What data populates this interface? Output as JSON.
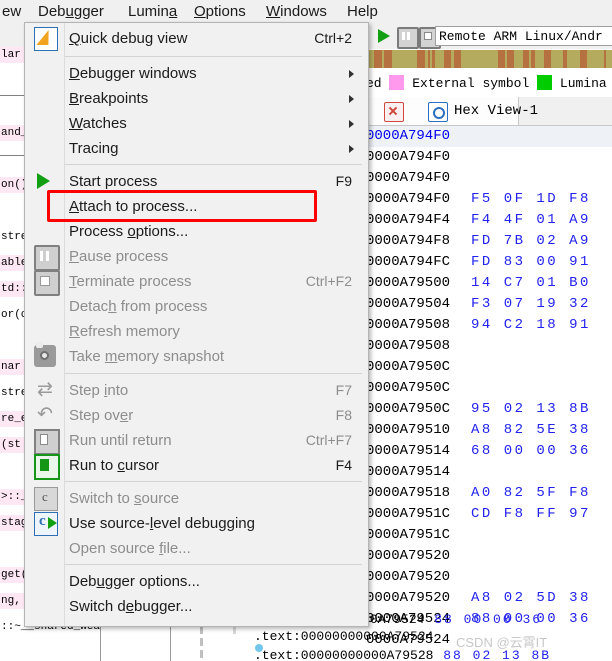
{
  "menubar": {
    "items": [
      {
        "label": "ew",
        "accel_index": -1
      },
      {
        "label": "Debugger",
        "accel_index": 3
      },
      {
        "label": "Lumina",
        "accel_index": 4
      },
      {
        "label": "Options",
        "accel_index": 0
      },
      {
        "label": "Windows",
        "accel_index": 0
      },
      {
        "label": "Help",
        "accel_index": -1
      }
    ]
  },
  "debugger_menu": {
    "items": [
      {
        "label": "Quick debug view",
        "accel": "Ctrl+2",
        "icon": "quick-debug-view-icon",
        "disabled": false,
        "submenu": false,
        "underline": 0
      },
      {
        "label": "Debugger windows",
        "accel": "",
        "icon": "",
        "disabled": false,
        "submenu": true,
        "underline": 0
      },
      {
        "label": "Breakpoints",
        "accel": "",
        "icon": "",
        "disabled": false,
        "submenu": true,
        "underline": 0
      },
      {
        "label": "Watches",
        "accel": "",
        "icon": "",
        "disabled": false,
        "submenu": true,
        "underline": 0
      },
      {
        "label": "Tracing",
        "accel": "",
        "icon": "",
        "disabled": false,
        "submenu": true,
        "underline": 6
      },
      {
        "label": "Start process",
        "accel": "F9",
        "icon": "play-icon",
        "disabled": false,
        "submenu": false,
        "underline": -1
      },
      {
        "label": "Attach to process...",
        "accel": "",
        "icon": "",
        "disabled": false,
        "submenu": false,
        "underline": 0,
        "highlighted": true
      },
      {
        "label": "Process options...",
        "accel": "",
        "icon": "",
        "disabled": false,
        "submenu": false,
        "underline": 8
      },
      {
        "label": "Pause process",
        "accel": "",
        "icon": "pause-icon",
        "disabled": true,
        "submenu": false,
        "underline": 0
      },
      {
        "label": "Terminate process",
        "accel": "Ctrl+F2",
        "icon": "stop-icon",
        "disabled": true,
        "submenu": false,
        "underline": 0
      },
      {
        "label": "Detach from process",
        "accel": "",
        "icon": "",
        "disabled": true,
        "submenu": false,
        "underline": 5
      },
      {
        "label": "Refresh memory",
        "accel": "",
        "icon": "",
        "disabled": true,
        "submenu": false,
        "underline": 0
      },
      {
        "label": "Take memory snapshot",
        "accel": "",
        "icon": "camera-icon",
        "disabled": true,
        "submenu": false,
        "underline": 5
      },
      {
        "label": "Step into",
        "accel": "F7",
        "icon": "step-into-icon",
        "disabled": true,
        "submenu": false,
        "underline": 5
      },
      {
        "label": "Step over",
        "accel": "F8",
        "icon": "step-over-icon",
        "disabled": true,
        "submenu": false,
        "underline": 7
      },
      {
        "label": "Run until return",
        "accel": "Ctrl+F7",
        "icon": "run-until-return-icon",
        "disabled": true,
        "submenu": false,
        "underline": -1
      },
      {
        "label": "Run to cursor",
        "accel": "F4",
        "icon": "run-to-cursor-icon",
        "disabled": false,
        "submenu": false,
        "underline": 7
      },
      {
        "label": "Switch to source",
        "accel": "",
        "icon": "switch-to-source-icon",
        "disabled": true,
        "submenu": false,
        "underline": 10
      },
      {
        "label": "Use source-level debugging",
        "accel": "",
        "icon": "source-level-debug-icon",
        "disabled": false,
        "submenu": false,
        "underline": 11
      },
      {
        "label": "Open source file...",
        "accel": "",
        "icon": "",
        "disabled": true,
        "submenu": false,
        "underline": 12
      },
      {
        "label": "Debugger options...",
        "accel": "",
        "icon": "",
        "disabled": false,
        "submenu": false,
        "underline": 3
      },
      {
        "label": "Switch debugger...",
        "accel": "",
        "icon": "",
        "disabled": false,
        "submenu": false,
        "underline": 8
      }
    ],
    "highlight_color": "#ff0000"
  },
  "debug_toolbar": {
    "process_selector_value": "Remote ARM Linux/Andr",
    "buttons": [
      "play-icon",
      "pause-icon",
      "stop-icon"
    ]
  },
  "legend": {
    "items": [
      {
        "label": "ed",
        "color": ""
      },
      {
        "label": "External symbol",
        "color": "#ff99ee"
      },
      {
        "label": "Lumina",
        "color": "#00cc00"
      }
    ]
  },
  "hex_view": {
    "tab_label": "Hex View-1",
    "close_icon": "close-icon",
    "dock_icon": "dock-icon",
    "rows": [
      {
        "addr": "0000A794F0",
        "bytes": "",
        "selected": true
      },
      {
        "addr": "0000A794F0",
        "bytes": "",
        "selected": false
      },
      {
        "addr": "0000A794F0",
        "bytes": "",
        "selected": false
      },
      {
        "addr": "0000A794F0",
        "bytes": "F5 0F 1D F8",
        "selected": false
      },
      {
        "addr": "0000A794F4",
        "bytes": "F4 4F 01 A9",
        "selected": false
      },
      {
        "addr": "0000A794F8",
        "bytes": "FD 7B 02 A9",
        "selected": false
      },
      {
        "addr": "0000A794FC",
        "bytes": "FD 83 00 91",
        "selected": false
      },
      {
        "addr": "0000A79500",
        "bytes": "14 C7 01 B0",
        "selected": false
      },
      {
        "addr": "0000A79504",
        "bytes": "F3 07 19 32",
        "selected": false
      },
      {
        "addr": "0000A79508",
        "bytes": "94 C2 18 91",
        "selected": false
      },
      {
        "addr": "0000A79508",
        "bytes": "",
        "selected": false
      },
      {
        "addr": "0000A7950C",
        "bytes": "",
        "selected": false
      },
      {
        "addr": "0000A7950C",
        "bytes": "",
        "selected": false
      },
      {
        "addr": "0000A7950C",
        "bytes": "95 02 13 8B",
        "selected": false
      },
      {
        "addr": "0000A79510",
        "bytes": "A8 82 5E 38",
        "selected": false
      },
      {
        "addr": "0000A79514",
        "bytes": "68 00 00 36",
        "selected": false
      },
      {
        "addr": "0000A79514",
        "bytes": "",
        "selected": false
      },
      {
        "addr": "0000A79518",
        "bytes": "A0 82 5F F8",
        "selected": false
      },
      {
        "addr": "0000A7951C",
        "bytes": "CD F8 FF 97",
        "selected": false
      },
      {
        "addr": "0000A7951C",
        "bytes": "",
        "selected": false
      },
      {
        "addr": "0000A79520",
        "bytes": "",
        "selected": false
      },
      {
        "addr": "0000A79520",
        "bytes": "",
        "selected": false
      },
      {
        "addr": "0000A79520",
        "bytes": "A8 02 5D 38",
        "selected": false
      },
      {
        "addr": "0000A79524",
        "bytes": "88 00 00 36",
        "selected": false
      },
      {
        "addr": "0000A79524",
        "bytes": "",
        "selected": false
      }
    ]
  },
  "disassembly_bottom": {
    "lines": [
      {
        "text": ".text:00000000000A79524",
        "bytes": "88 00 00 36"
      },
      {
        "text": ".text:00000000000A79524",
        "bytes": ""
      },
      {
        "text": ".text:00000000000A79528",
        "bytes": "88 02 13 8B"
      }
    ]
  },
  "left_pane": {
    "lines": [
      "lar",
      "",
      "",
      "and_:",
      "",
      "on()",
      "",
      "stre",
      "able",
      "td::",
      "or(cl",
      "",
      "nar ",
      "stre",
      "re_e",
      "(st",
      "",
      ">::_",
      "stag",
      "",
      "get(",
      "ng, u",
      "::~__shared_weak_"
    ]
  },
  "watermark": "CSDN @云霄IT",
  "colors": {
    "menu_bg": "#f1f1f1",
    "highlight_red": "#ff0000",
    "hex_blue": "#2222ee",
    "nav_olive": "#b5ab5e",
    "nav_brown": "#b5713f",
    "external_symbol": "#ff99ee",
    "lumina_green": "#00cc00",
    "selected_row": "#eef2f7"
  }
}
